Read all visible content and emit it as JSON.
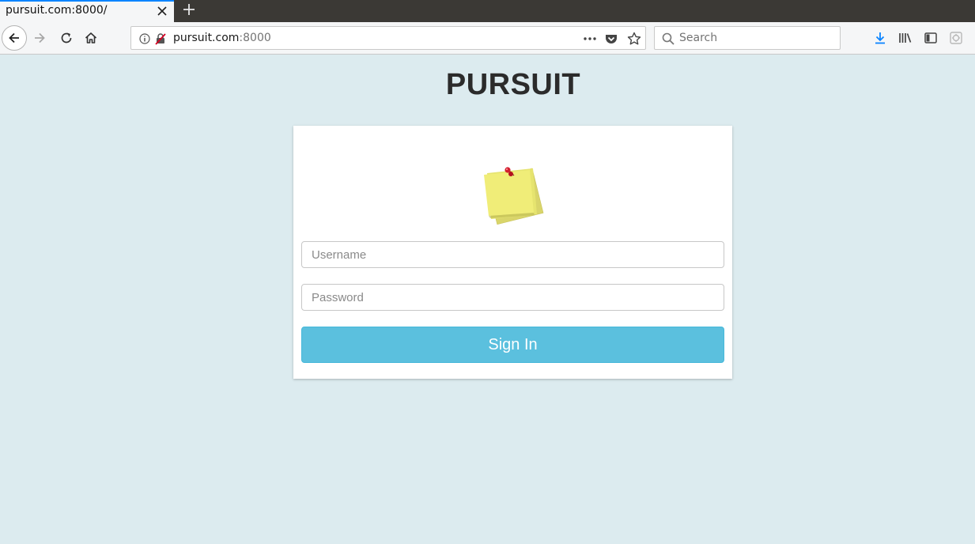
{
  "browser": {
    "tab_title": "pursuit.com:8000/",
    "url_host": "pursuit.com",
    "url_port": ":8000",
    "search_placeholder": "Search",
    "accent_color": "#0a84ff"
  },
  "page": {
    "title": "PURSUIT",
    "username_placeholder": "Username",
    "password_placeholder": "Password",
    "signin_label": "Sign In",
    "background_color": "#dcebef",
    "button_color": "#5bc0de"
  }
}
